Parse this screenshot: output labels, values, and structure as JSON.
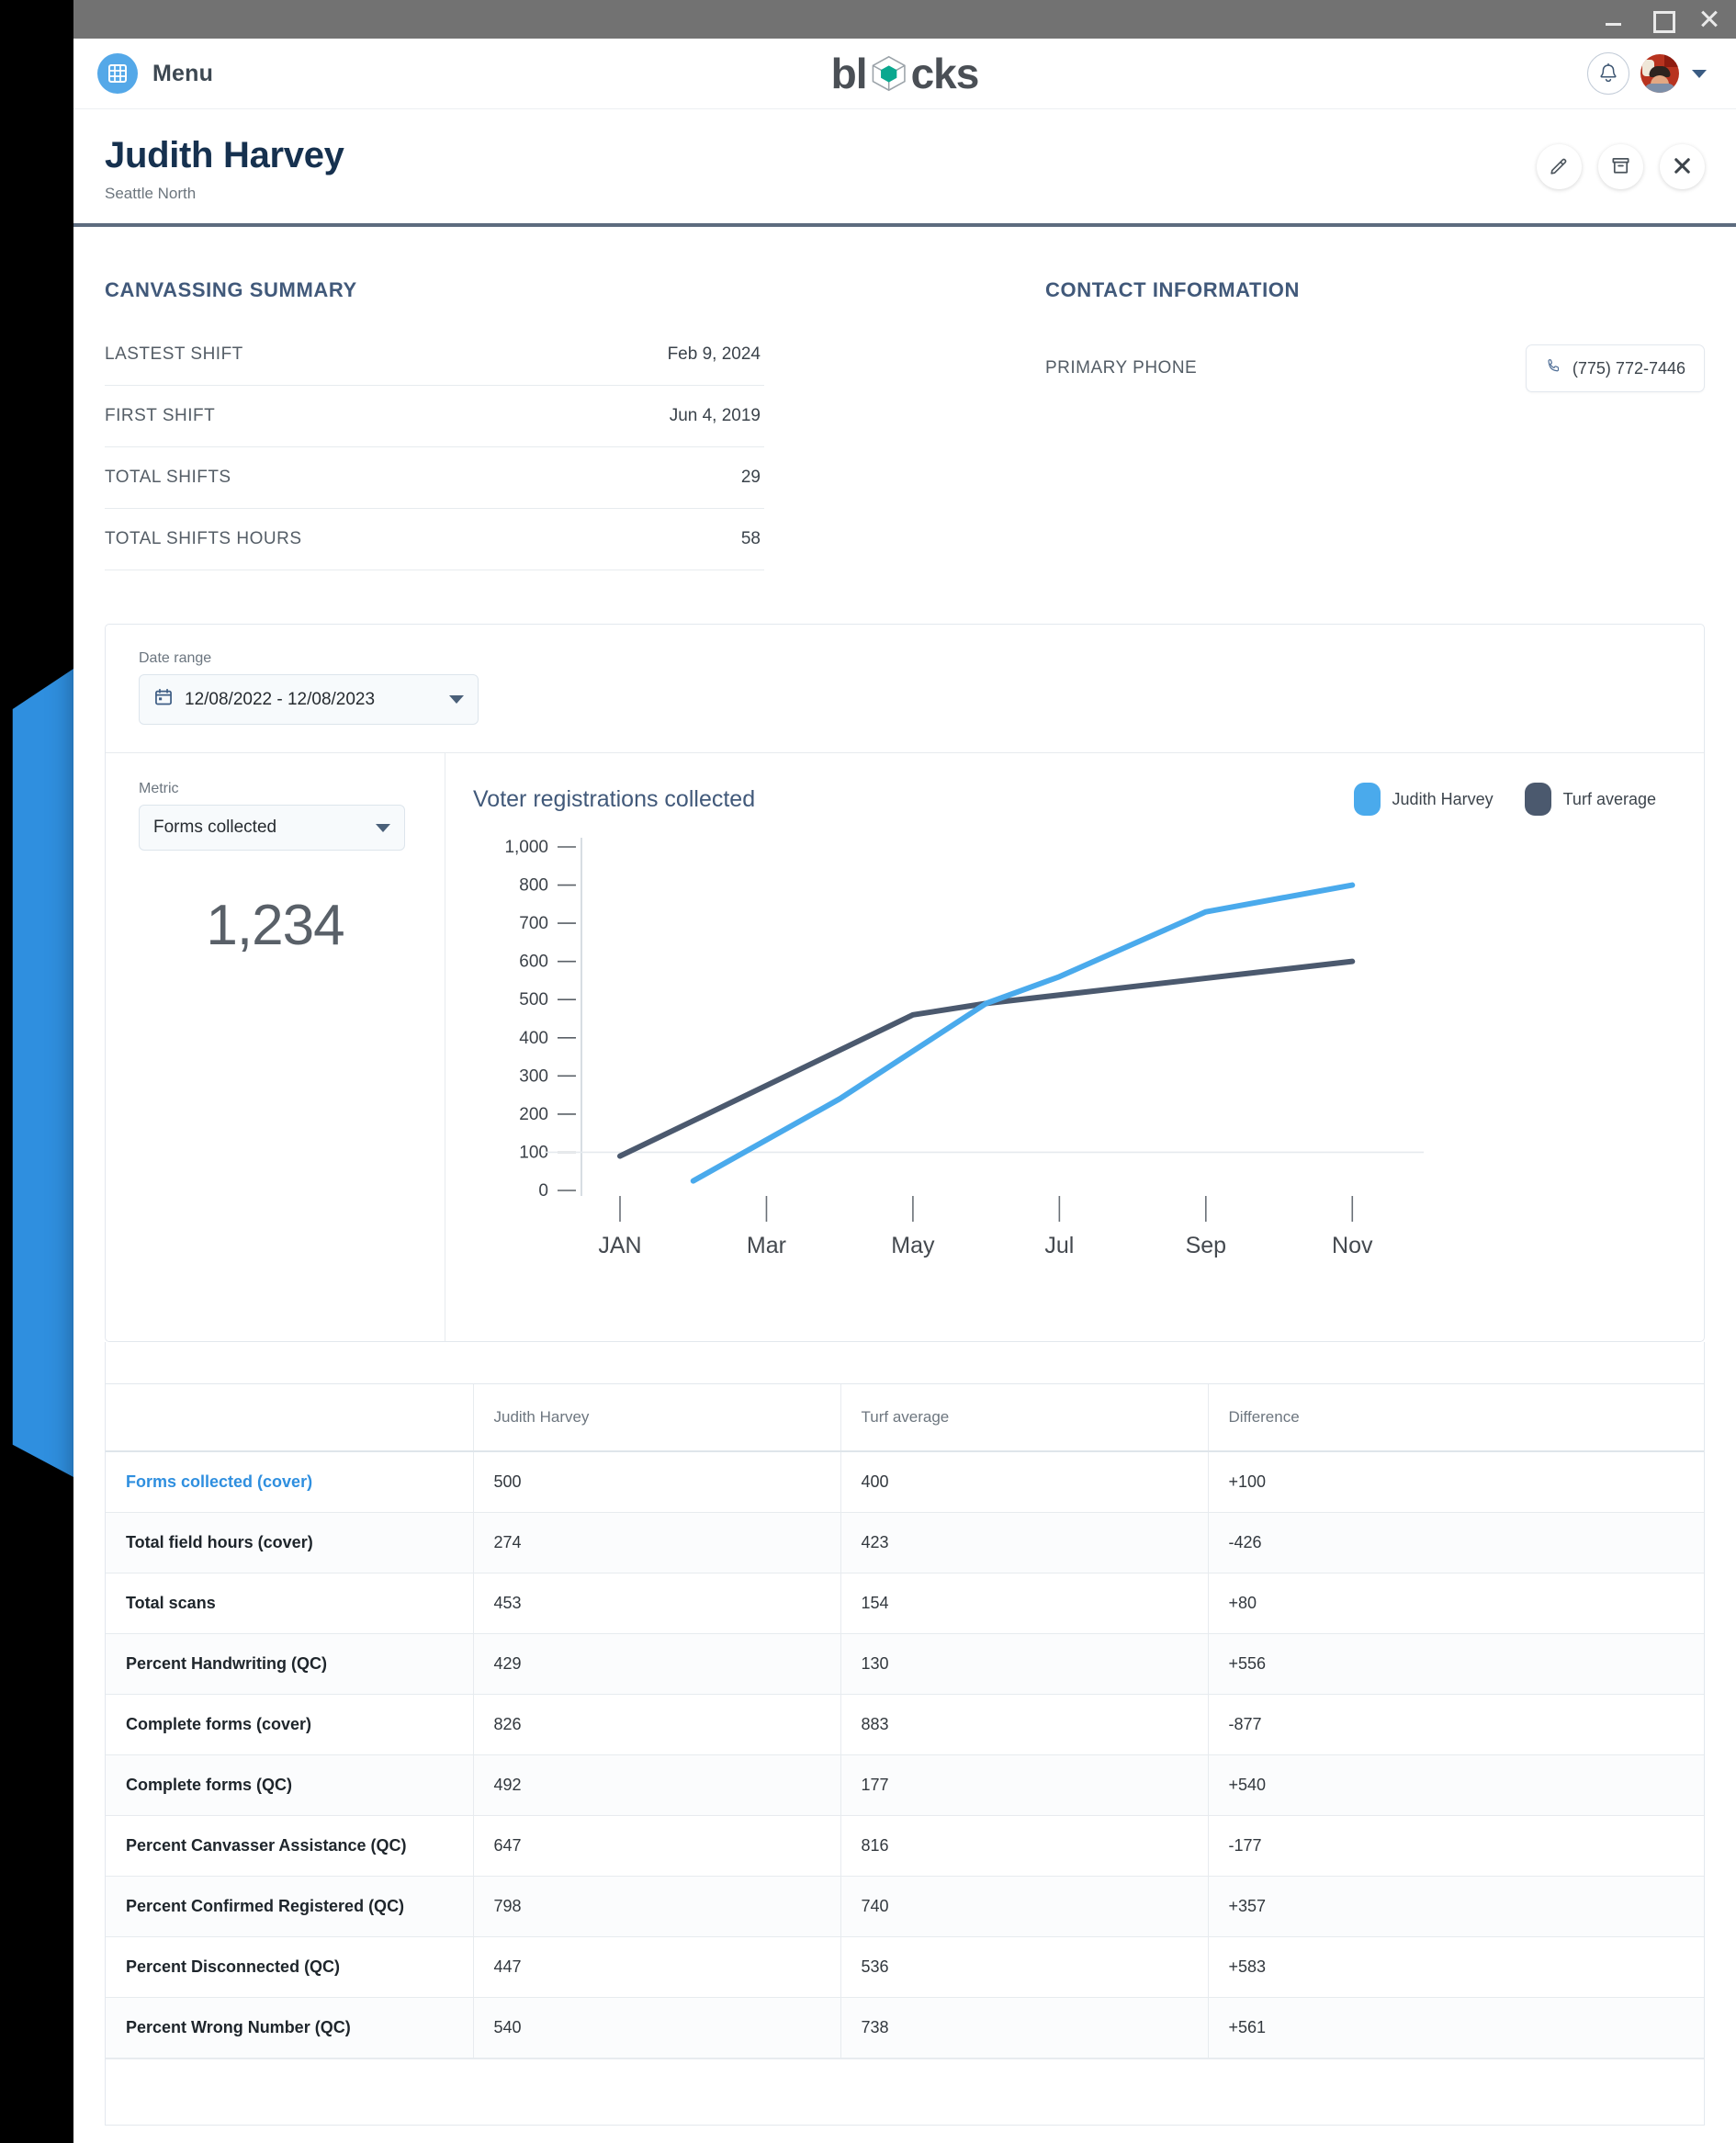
{
  "window": {
    "minimize_label": "minimize",
    "maximize_label": "maximize",
    "close_label": "close"
  },
  "app_header": {
    "menu_label": "Menu",
    "menu_icon": "grid-icon",
    "logo_before": "bl",
    "logo_after": "cks",
    "logo_cube_icon": "cube-icon",
    "logo_accent_color": "#0aa88f",
    "notifications_icon": "bell-icon",
    "avatar_icon": "user-avatar",
    "account_caret_icon": "chevron-down-icon"
  },
  "page_header": {
    "title": "Judith Harvey",
    "subtitle": "Seattle North",
    "actions": [
      {
        "name": "edit-button",
        "icon": "pencil-icon"
      },
      {
        "name": "archive-button",
        "icon": "archive-box-icon"
      },
      {
        "name": "close-button",
        "icon": "close-x-icon"
      }
    ]
  },
  "canvassing_summary": {
    "title": "CANVASSING SUMMARY",
    "rows": [
      {
        "label": "LASTEST SHIFT",
        "value": "Feb 9, 2024"
      },
      {
        "label": "FIRST SHIFT",
        "value": "Jun 4, 2019"
      },
      {
        "label": "TOTAL SHIFTS",
        "value": "29"
      },
      {
        "label": "TOTAL SHIFTS HOURS",
        "value": "58"
      }
    ]
  },
  "contact_information": {
    "title": "CONTACT INFORMATION",
    "primary_phone_label": "PRIMARY PHONE",
    "primary_phone_value": "(775) 772-7446",
    "phone_icon": "phone-icon"
  },
  "chart_card": {
    "date_range_label": "Date range",
    "date_range_value": "12/08/2022 - 12/08/2023",
    "calendar_icon": "calendar-icon",
    "metric_label": "Metric",
    "metric_value": "Forms collected",
    "metric_total": "1,234",
    "caret_icon": "caret-down-icon"
  },
  "chart_data": {
    "type": "line",
    "title": "Voter registrations collected",
    "xlabel": "",
    "ylabel": "",
    "grid": false,
    "legend_position": "top-right",
    "x_ticks": [
      "JAN",
      "Mar",
      "May",
      "Jul",
      "Sep",
      "Nov"
    ],
    "y_ticks": [
      "0",
      "100",
      "200",
      "300",
      "400",
      "500",
      "600",
      "700",
      "800",
      "1,000"
    ],
    "ylim": [
      0,
      1000
    ],
    "series": [
      {
        "name": "Judith Harvey",
        "color": "#4aaaec",
        "points": [
          {
            "x": "Feb",
            "y": 25
          },
          {
            "x": "Apr",
            "y": 240
          },
          {
            "x": "Jun",
            "y": 490
          },
          {
            "x": "Jul",
            "y": 560
          },
          {
            "x": "Sep",
            "y": 730
          },
          {
            "x": "Nov",
            "y": 800
          }
        ]
      },
      {
        "name": "Turf average",
        "color": "#4b596e",
        "points": [
          {
            "x": "JAN",
            "y": 90
          },
          {
            "x": "May",
            "y": 460
          },
          {
            "x": "Jun",
            "y": 490
          },
          {
            "x": "Nov",
            "y": 600
          }
        ]
      }
    ]
  },
  "comparison_table": {
    "headers": [
      "",
      "Judith Harvey",
      "Turf average",
      "Difference"
    ],
    "rows": [
      {
        "label": "Forms collected (cover)",
        "is_link": true,
        "judith": "500",
        "turf": "400",
        "difference": "+100"
      },
      {
        "label": "Total field hours (cover)",
        "is_link": false,
        "judith": "274",
        "turf": "423",
        "difference": "-426"
      },
      {
        "label": "Total scans",
        "is_link": false,
        "judith": "453",
        "turf": "154",
        "difference": "+80"
      },
      {
        "label": "Percent Handwriting (QC)",
        "is_link": false,
        "judith": "429",
        "turf": "130",
        "difference": "+556"
      },
      {
        "label": "Complete forms (cover)",
        "is_link": false,
        "judith": "826",
        "turf": "883",
        "difference": "-877"
      },
      {
        "label": "Complete forms (QC)",
        "is_link": false,
        "judith": "492",
        "turf": "177",
        "difference": "+540"
      },
      {
        "label": "Percent Canvasser Assistance (QC)",
        "is_link": false,
        "judith": "647",
        "turf": "816",
        "difference": "-177"
      },
      {
        "label": "Percent Confirmed Registered (QC)",
        "is_link": false,
        "judith": "798",
        "turf": "740",
        "difference": "+357"
      },
      {
        "label": "Percent Disconnected (QC)",
        "is_link": false,
        "judith": "447",
        "turf": "536",
        "difference": "+583"
      },
      {
        "label": "Percent Wrong Number (QC)",
        "is_link": false,
        "judith": "540",
        "turf": "738",
        "difference": "+561"
      }
    ]
  }
}
